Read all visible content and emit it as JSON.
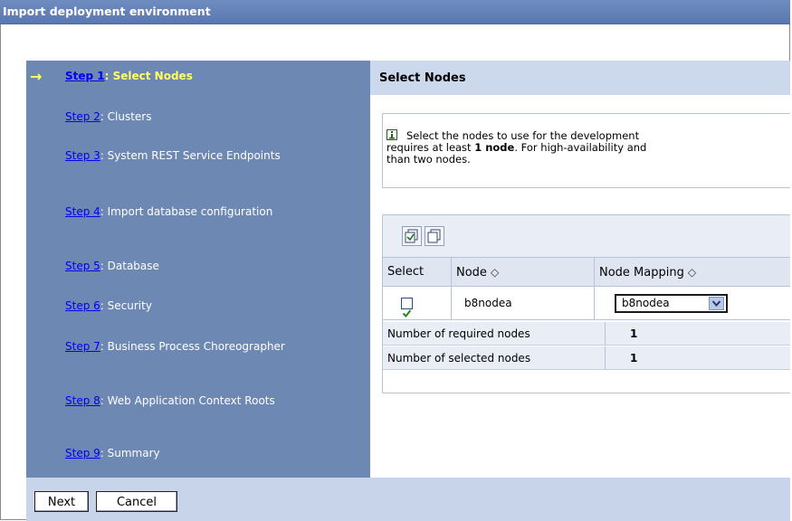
{
  "window": {
    "title": "Import deployment environment"
  },
  "steps": [
    {
      "link": "Step 1",
      "label": ": Select Nodes",
      "active": true
    },
    {
      "link": "Step 2",
      "label": ": Clusters"
    },
    {
      "link": "Step 3",
      "label": ": System REST Service Endpoints"
    },
    {
      "link": "Step 4",
      "label": ": Import database configuration"
    },
    {
      "link": "Step 5",
      "label": ": Database"
    },
    {
      "link": "Step 6",
      "label": ": Security"
    },
    {
      "link": "Step 7",
      "label": ": Business Process Choreographer"
    },
    {
      "link": "Step 8",
      "label": ": Web Application Context Roots"
    },
    {
      "link": "Step 9",
      "label": ": Summary"
    }
  ],
  "content": {
    "title": "Select Nodes",
    "info": {
      "line1": "Select the nodes to use for the development",
      "line2_pre": "requires at least ",
      "line2_bold": "1 node",
      "line2_post": ".  For high-availability and",
      "line3": "than two nodes."
    },
    "table": {
      "headers": {
        "select": "Select",
        "node": "Node",
        "mapping": "Node Mapping"
      },
      "sort_glyph": "◇",
      "rows": [
        {
          "selected": true,
          "node": "b8nodea",
          "mapping": "b8nodea"
        }
      ],
      "summary": [
        {
          "label": "Number of required nodes",
          "value": "1"
        },
        {
          "label": "Number of selected nodes",
          "value": "1"
        }
      ]
    }
  },
  "footer": {
    "next_label": "Next",
    "cancel_label": "Cancel"
  },
  "colors": {
    "title_bar": "#6f8cc0",
    "sidebar": "#6e88b4",
    "active_step": "#ffff66",
    "link": "#0000ee",
    "header_band": "#ccd8ec",
    "footer": "#c7d4ea"
  }
}
